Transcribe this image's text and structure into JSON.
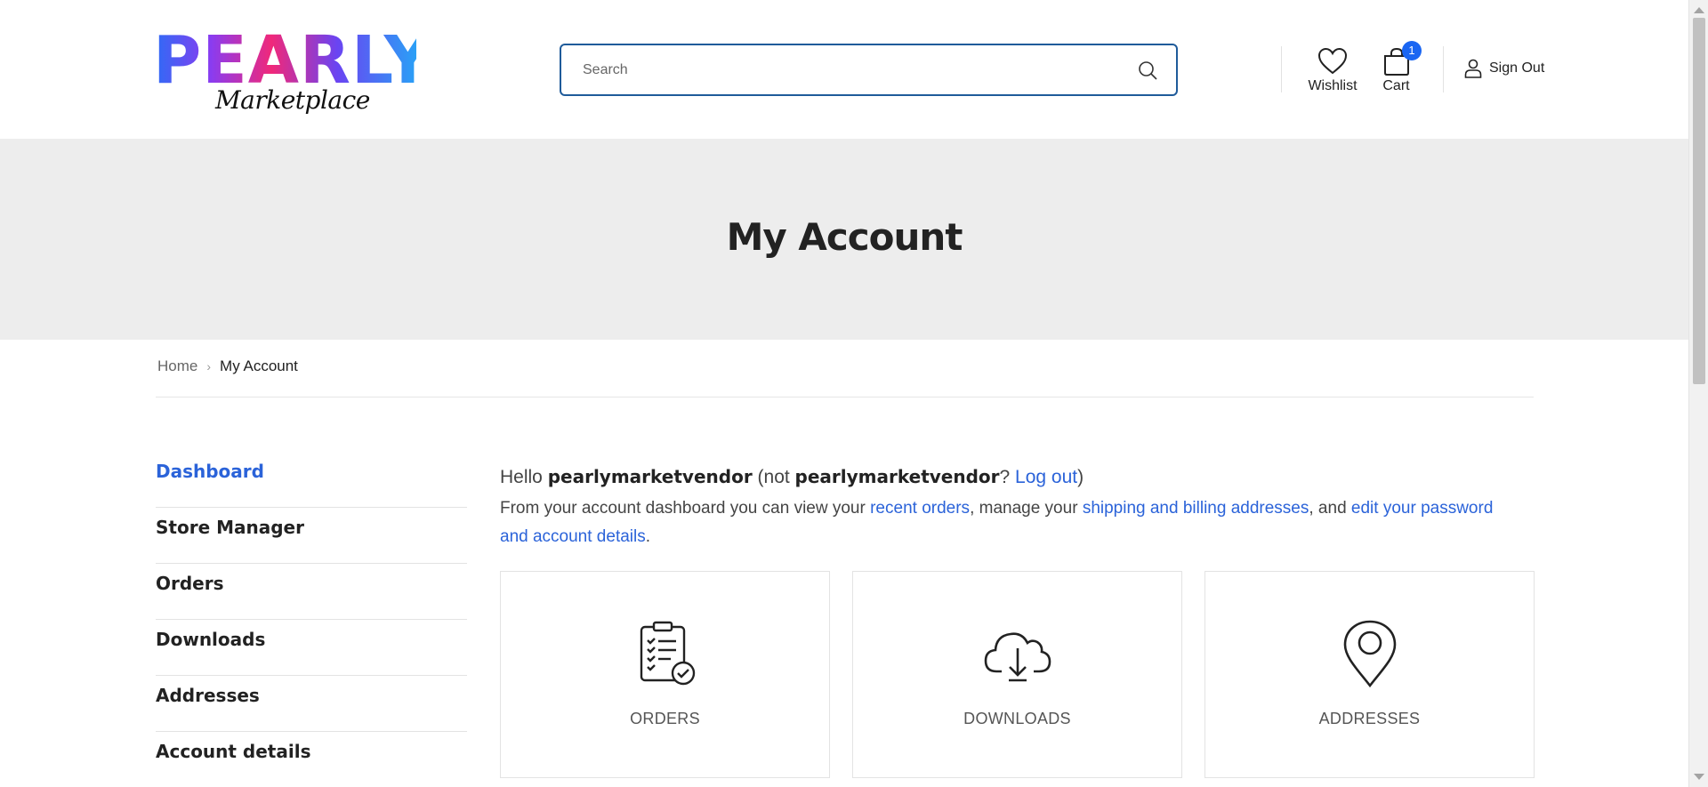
{
  "logo": {
    "main": "PEARLY",
    "sub": "Marketplace"
  },
  "search": {
    "placeholder": "Search",
    "icon": "search-icon"
  },
  "header": {
    "wishlist_label": "Wishlist",
    "cart_label": "Cart",
    "cart_count": "1",
    "signout_label": "Sign Out"
  },
  "banner": {
    "title": "My Account"
  },
  "breadcrumb": {
    "home": "Home",
    "separator": "›",
    "current": "My Account"
  },
  "sidebar": {
    "items": [
      {
        "label": "Dashboard",
        "active": true
      },
      {
        "label": "Store Manager"
      },
      {
        "label": "Orders"
      },
      {
        "label": "Downloads"
      },
      {
        "label": "Addresses"
      },
      {
        "label": "Account details"
      }
    ]
  },
  "main": {
    "hello_prefix": "Hello ",
    "username": "pearlymarketvendor",
    "not_prefix": " (not ",
    "username2": "pearlymarketvendor",
    "question": "? ",
    "logout_link": "Log out",
    "close_paren": ")",
    "intro_1": "From your account dashboard you can view your ",
    "recent_orders_link": "recent orders",
    "intro_2": ", manage your ",
    "addresses_link": "shipping and billing addresses",
    "intro_3": ", and ",
    "account_link": "edit your password and account details",
    "intro_4": "."
  },
  "cards": [
    {
      "label": "ORDERS",
      "icon": "clipboard-check-icon"
    },
    {
      "label": "DOWNLOADS",
      "icon": "cloud-download-icon"
    },
    {
      "label": "ADDRESSES",
      "icon": "map-pin-icon"
    }
  ],
  "colors": {
    "accent": "#2b63d9",
    "badge": "#1a66f2",
    "banner_bg": "#ededed",
    "search_border": "#1f5b9a"
  }
}
